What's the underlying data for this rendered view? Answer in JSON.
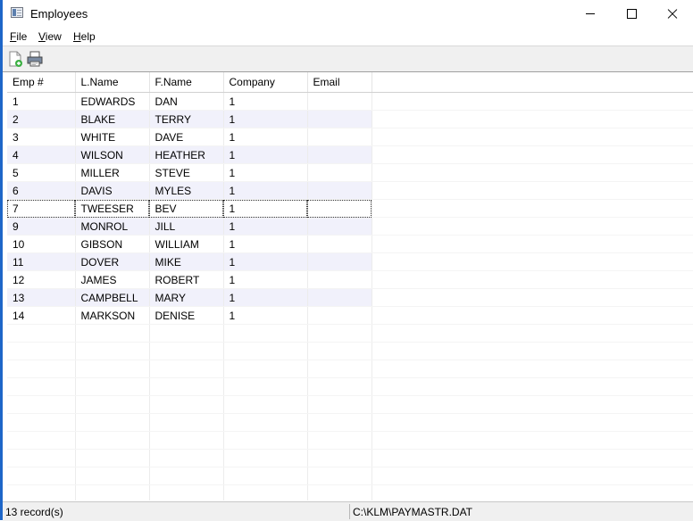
{
  "window": {
    "title": "Employees"
  },
  "menu": [
    {
      "label": "File",
      "accel": "F",
      "rest": "ile"
    },
    {
      "label": "View",
      "accel": "V",
      "rest": "iew"
    },
    {
      "label": "Help",
      "accel": "H",
      "rest": "elp"
    }
  ],
  "toolbar": {
    "icons": [
      "new-document-icon",
      "print-icon"
    ]
  },
  "grid": {
    "columns": [
      "Emp #",
      "L.Name",
      "F.Name",
      "Company",
      "Email"
    ],
    "rows": [
      [
        "1",
        "EDWARDS",
        "DAN",
        "1",
        ""
      ],
      [
        "2",
        "BLAKE",
        "TERRY",
        "1",
        ""
      ],
      [
        "3",
        "WHITE",
        "DAVE",
        "1",
        ""
      ],
      [
        "4",
        "WILSON",
        "HEATHER",
        "1",
        ""
      ],
      [
        "5",
        "MILLER",
        "STEVE",
        "1",
        ""
      ],
      [
        "6",
        "DAVIS",
        "MYLES",
        "1",
        ""
      ],
      [
        "7",
        "TWEESER",
        "BEV",
        "1",
        ""
      ],
      [
        "9",
        "MONROL",
        "JILL",
        "1",
        ""
      ],
      [
        "10",
        "GIBSON",
        "WILLIAM",
        "1",
        ""
      ],
      [
        "11",
        "DOVER",
        "MIKE",
        "1",
        ""
      ],
      [
        "12",
        "JAMES",
        "ROBERT",
        "1",
        ""
      ],
      [
        "13",
        "CAMPBELL",
        "MARY",
        "1",
        ""
      ],
      [
        "14",
        "MARKSON",
        "DENISE",
        "1",
        ""
      ]
    ],
    "focused_row": 6,
    "alt_row_color": "#f1f1fb"
  },
  "status": {
    "records": "13 record(s)",
    "path": "C:\\KLM\\PAYMASTR.DAT"
  },
  "colors": {
    "window_border": "#1e66c8"
  }
}
